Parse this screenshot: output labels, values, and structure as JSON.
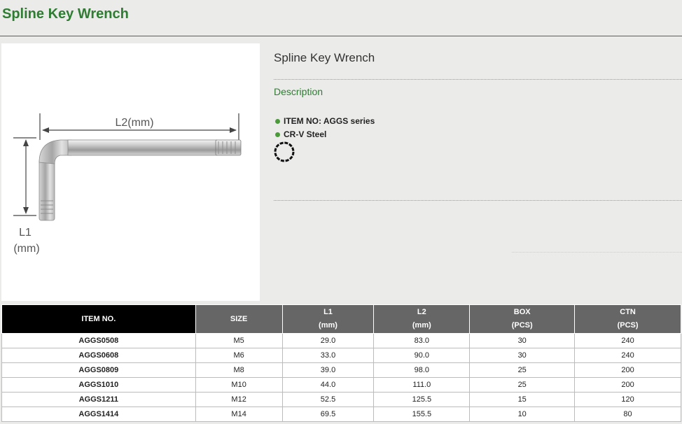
{
  "header": {
    "title": "Spline Key Wrench"
  },
  "diagram": {
    "l2_label": "L2(mm)",
    "l1_label": "L1",
    "l1_unit": "(mm)"
  },
  "product": {
    "name": "Spline Key Wrench",
    "description_heading": "Description",
    "specs": [
      "ITEM NO: AGGS series",
      "CR-V Steel"
    ],
    "bullet_color": "#4a9a3a",
    "feature_icon": "spline-profile-icon"
  },
  "colors": {
    "brand_green": "#2e7d32",
    "table_header": "#666666",
    "table_header_first": "#000000"
  },
  "table": {
    "headers": [
      {
        "line1": "ITEM NO.",
        "line2": ""
      },
      {
        "line1": "SIZE",
        "line2": ""
      },
      {
        "line1": "L1",
        "line2": "(mm)"
      },
      {
        "line1": "L2",
        "line2": "(mm)"
      },
      {
        "line1": "BOX",
        "line2": "(PCS)"
      },
      {
        "line1": "CTN",
        "line2": "(PCS)"
      }
    ],
    "rows": [
      [
        "AGGS0508",
        "M5",
        "29.0",
        "83.0",
        "30",
        "240"
      ],
      [
        "AGGS0608",
        "M6",
        "33.0",
        "90.0",
        "30",
        "240"
      ],
      [
        "AGGS0809",
        "M8",
        "39.0",
        "98.0",
        "25",
        "200"
      ],
      [
        "AGGS1010",
        "M10",
        "44.0",
        "111.0",
        "25",
        "200"
      ],
      [
        "AGGS1211",
        "M12",
        "52.5",
        "125.5",
        "15",
        "120"
      ],
      [
        "AGGS1414",
        "M14",
        "69.5",
        "155.5",
        "10",
        "80"
      ]
    ]
  }
}
